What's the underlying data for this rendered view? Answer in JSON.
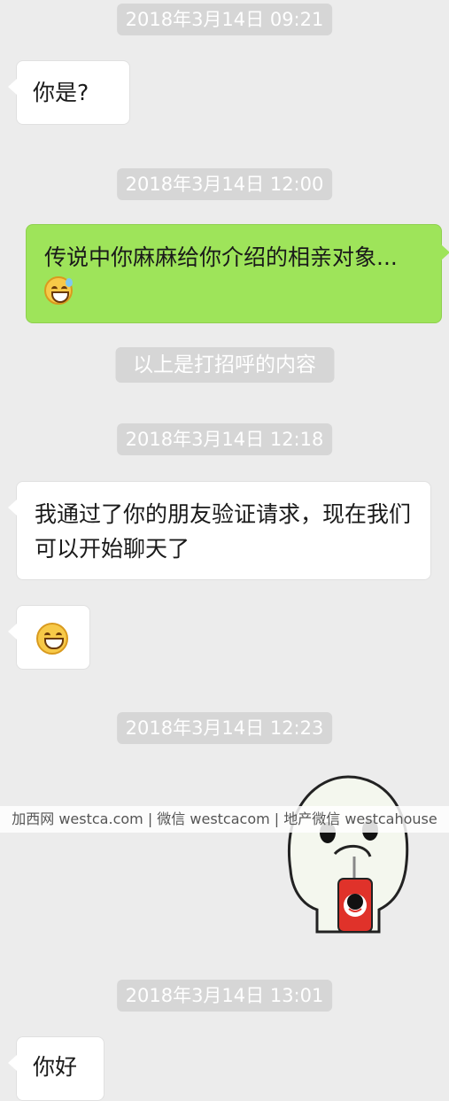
{
  "chat": {
    "timestamps": {
      "t1": "2018年3月14日 09:21",
      "t2": "2018年3月14日 12:00",
      "t3": "2018年3月14日 12:18",
      "t4": "2018年3月14日 12:23",
      "t5": "2018年3月14日 13:01"
    },
    "messages": {
      "m1": "你是?",
      "m2": "传说中你麻麻给你介绍的相亲对象...",
      "m3": "我通过了你的朋友验证请求，现在我们可以开始聊天了",
      "m6": "你好"
    },
    "system_notice": "以上是打招呼的内容",
    "emoji_names": {
      "m2_emoji": "grinning-sweat-emoji",
      "m4_emoji": "grinning-emoji",
      "m5_sticker": "cartoon-ghost-drinking-sticker"
    }
  },
  "watermark": "加西网 westca.com | 微信 westcacom | 地产微信 westcahouse",
  "colors": {
    "background": "#ececec",
    "outgoing_bubble": "#9ee45a",
    "incoming_bubble": "#ffffff",
    "timestamp_bg": "#d6d6d6"
  }
}
